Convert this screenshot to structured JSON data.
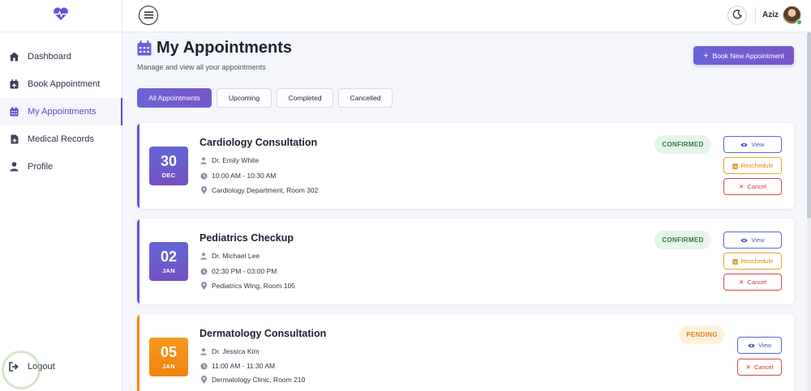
{
  "app": {
    "logo_icon": "heart-pulse-icon",
    "accent": "#6a63d8"
  },
  "sidebar": {
    "items": [
      {
        "label": "Dashboard",
        "icon": "home-icon"
      },
      {
        "label": "Book Appointment",
        "icon": "calendar-plus-icon"
      },
      {
        "label": "My Appointments",
        "icon": "calendar-icon",
        "active": true
      },
      {
        "label": "Medical Records",
        "icon": "file-medical-icon"
      },
      {
        "label": "Profile",
        "icon": "user-icon"
      }
    ],
    "logout_label": "Logout"
  },
  "topbar": {
    "user_name": "Aziz",
    "theme_icon": "moon-icon",
    "menu_icon": "hamburger-icon"
  },
  "page": {
    "title": "My Appointments",
    "subtitle": "Manage and view all your appointments",
    "book_button": "Book New Appointment"
  },
  "filters": [
    {
      "label": "All Appointments",
      "active": true
    },
    {
      "label": "Upcoming"
    },
    {
      "label": "Completed"
    },
    {
      "label": "Cancelled"
    }
  ],
  "actions": {
    "view": "View",
    "reschedule": "Reschedule",
    "cancel": "Cancel"
  },
  "appointments": [
    {
      "day": "30",
      "month": "DEC",
      "title": "Cardiology Consultation",
      "doctor": "Dr. Emily White",
      "time": "10:00 AM - 10:30 AM",
      "location": "Cardiology Department, Room 302",
      "status": "CONFIRMED",
      "status_color": "#2e7a43"
    },
    {
      "day": "02",
      "month": "JAN",
      "title": "Pediatrics Checkup",
      "doctor": "Dr. Michael Lee",
      "time": "02:30 PM - 03:00 PM",
      "location": "Pediatrics Wing, Room 105",
      "status": "CONFIRMED",
      "status_color": "#2e7a43"
    },
    {
      "day": "05",
      "month": "JAN",
      "title": "Dermatology Consultation",
      "doctor": "Dr. Jessica Kim",
      "time": "11:00 AM - 11:30 AM",
      "location": "Dermatology Clinic, Room 210",
      "status": "PENDING",
      "status_color": "#d8861a"
    }
  ]
}
